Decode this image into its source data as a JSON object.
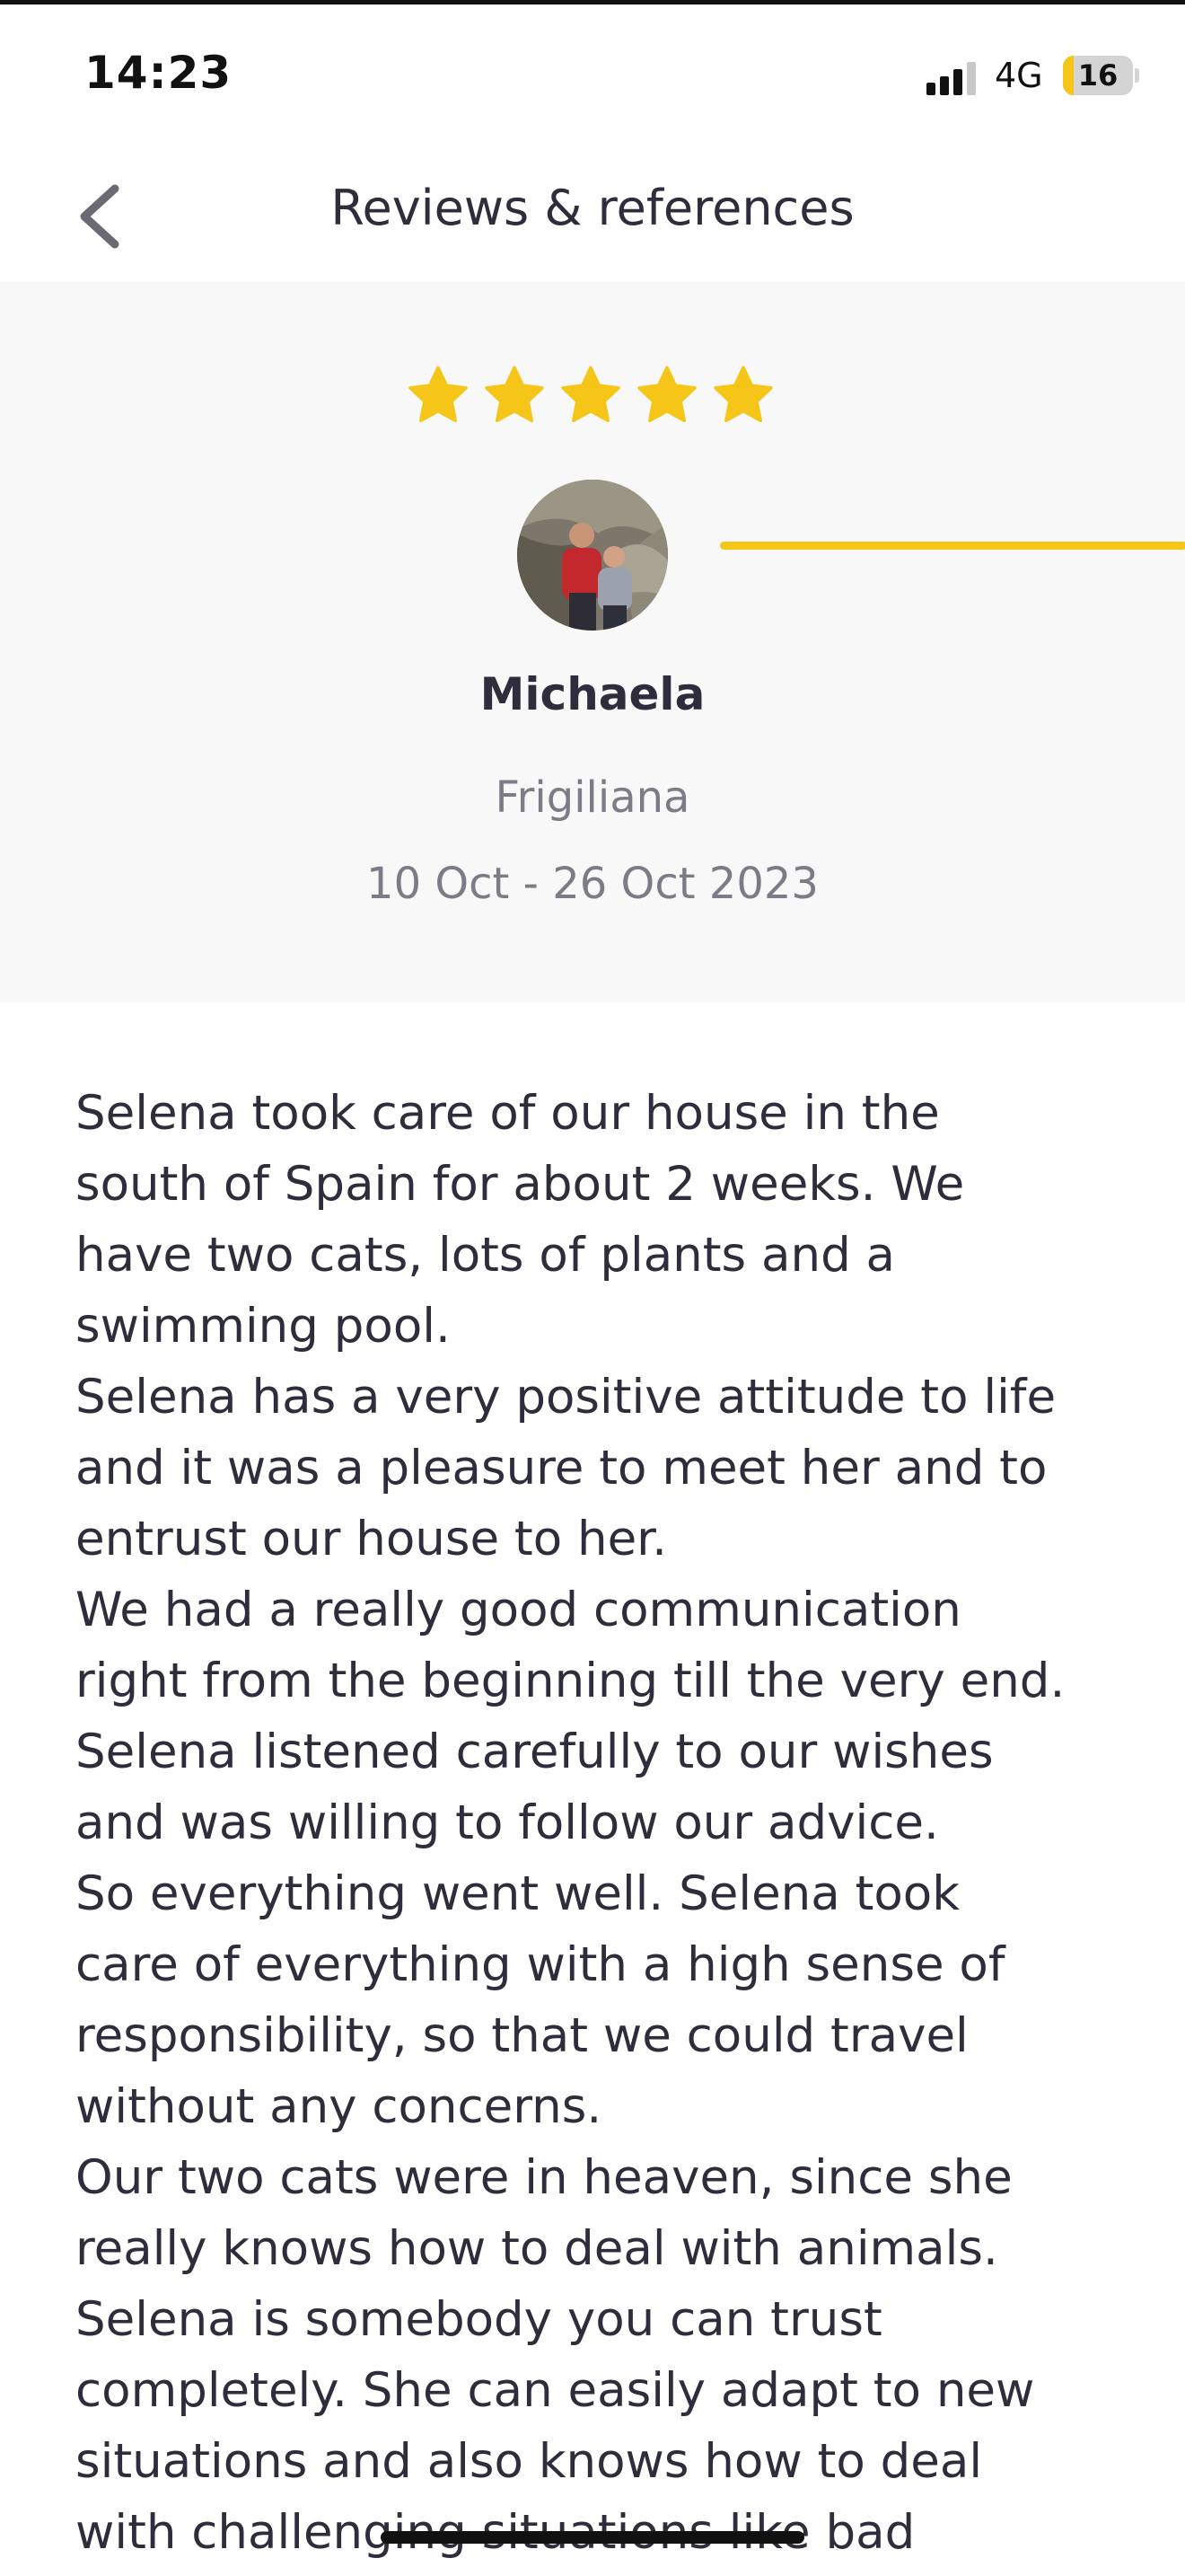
{
  "status_bar": {
    "time": "14:23",
    "network": "4G",
    "battery_level": "16",
    "signal_bars_active": 3,
    "signal_bars_total": 4,
    "battery_fill_fraction": 0.16
  },
  "header": {
    "title": "Reviews & references",
    "back_icon": "chevron-left-icon"
  },
  "review": {
    "rating": 5,
    "rating_max": 5,
    "star_icon": "star-icon",
    "star_color": "#f5c518",
    "reviewer_name": "Michaela",
    "location": "Frigiliana",
    "dates": "10 Oct - 26 Oct 2023",
    "body_lines": [
      "Selena took care of our house in the",
      "south of Spain for about 2 weeks. We",
      "have two cats, lots of plants and a",
      "swimming pool.",
      "Selena has a very positive attitude to life",
      "and it was a pleasure to meet her and to",
      "entrust our house to her.",
      "We had a really good communication",
      "right from the beginning till the very end.",
      "Selena listened carefully to our wishes",
      "and was willing to follow our advice.",
      "So everything went well. Selena took",
      "care of everything with a high sense of",
      "responsibility, so that we could travel",
      "without any concerns.",
      "Our two cats were in heaven, since she",
      "really knows how to deal with animals.",
      "Selena is somebody you can trust",
      "completely. She can easily adapt to new",
      "situations and also knows how to deal",
      "with challenging situations like bad"
    ]
  },
  "colors": {
    "accent": "#f5c518",
    "text_primary": "#2f2c3c",
    "text_secondary": "#7d7b85",
    "panel_background": "#f8f8f8"
  }
}
